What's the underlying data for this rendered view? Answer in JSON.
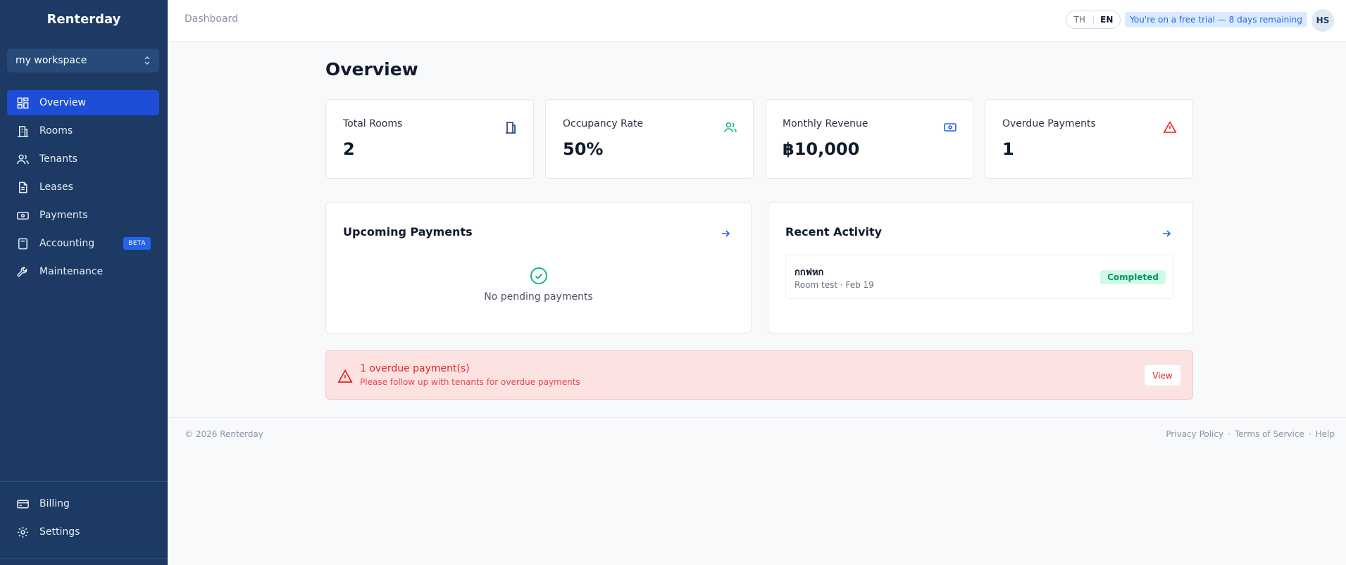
{
  "app": {
    "brand": "Renterday"
  },
  "workspace": {
    "name": "my workspace"
  },
  "sidebar": {
    "items": [
      {
        "label": "Overview",
        "icon": "dashboard-icon"
      },
      {
        "label": "Rooms",
        "icon": "building-icon"
      },
      {
        "label": "Tenants",
        "icon": "users-icon"
      },
      {
        "label": "Leases",
        "icon": "document-icon"
      },
      {
        "label": "Payments",
        "icon": "banknote-icon"
      },
      {
        "label": "Accounting",
        "icon": "calculator-icon",
        "badge": "BETA"
      },
      {
        "label": "Maintenance",
        "icon": "wrench-icon"
      }
    ],
    "bottom": [
      {
        "label": "Billing",
        "icon": "credit-card-icon"
      },
      {
        "label": "Settings",
        "icon": "gear-icon"
      }
    ]
  },
  "topbar": {
    "breadcrumb": "Dashboard",
    "lang_th": "TH",
    "lang_en": "EN",
    "trial": "You're on a free trial — 8 days remaining",
    "avatar": "HS"
  },
  "main": {
    "title": "Overview",
    "stats": [
      {
        "label": "Total Rooms",
        "value": "2"
      },
      {
        "label": "Occupancy Rate",
        "value": "50%"
      },
      {
        "label": "Monthly Revenue",
        "value": "฿10,000"
      },
      {
        "label": "Overdue Payments",
        "value": "1"
      }
    ],
    "upcoming": {
      "title": "Upcoming Payments",
      "empty": "No pending payments"
    },
    "activity": {
      "title": "Recent Activity",
      "items": [
        {
          "name": "กกฟหก",
          "meta": "Room test · Feb 19",
          "status": "Completed"
        }
      ]
    },
    "alert": {
      "title": "1 overdue payment(s)",
      "desc": "Please follow up with tenants for overdue payments",
      "button": "View"
    }
  },
  "footer": {
    "copyright": "© 2026 Renterday",
    "privacy": "Privacy Policy",
    "terms": "Terms of Service",
    "help": "Help",
    "sep": "·"
  },
  "colors": {
    "sidebar": "#1c3a63",
    "accent": "#1d4ed8",
    "danger": "#dc2626",
    "success": "#059669"
  }
}
